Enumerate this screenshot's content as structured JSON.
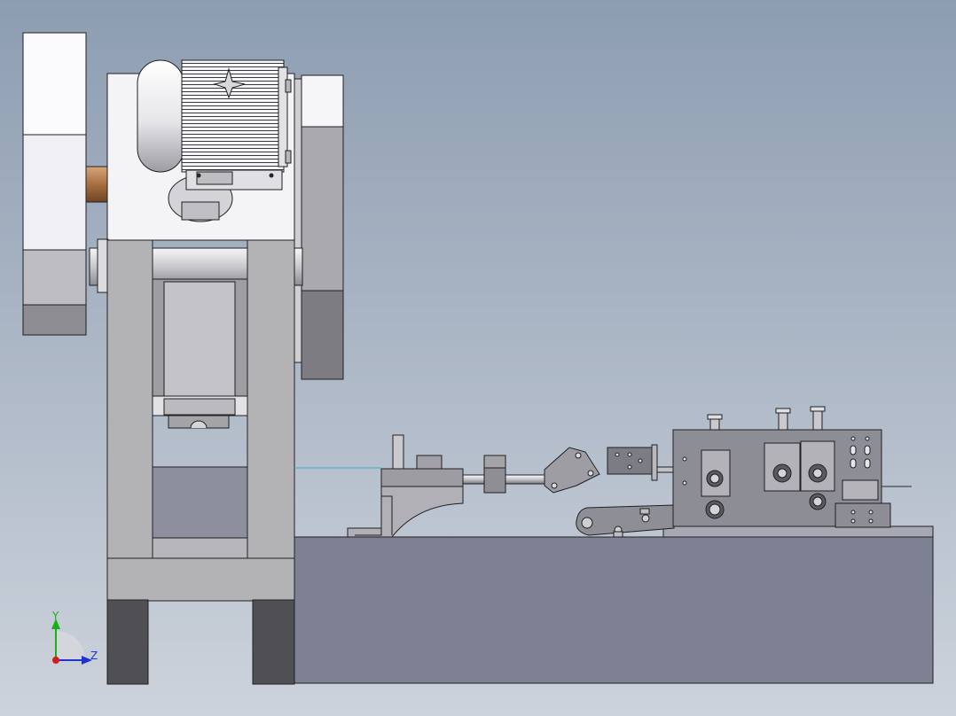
{
  "viewport": {
    "background_top": "#8d9db1",
    "background_bottom": "#cdd3dc"
  },
  "colors": {
    "frame_light": "#f4f4f6",
    "frame_gray": "#b3b3b5",
    "frame_dark": "#8f8f93",
    "base_body": "#7e8193",
    "base_top": "#a6a8b4",
    "feeder": "#8d8d96",
    "feeder_dark": "#6c6c74",
    "shaft_bronze": "#b07a4c",
    "outline": "#202022",
    "axis_y": "#18b018",
    "axis_z": "#1c35d0",
    "axis_x": "#d21b1b"
  },
  "triad": {
    "y_label": "Y",
    "z_label": "Z"
  }
}
